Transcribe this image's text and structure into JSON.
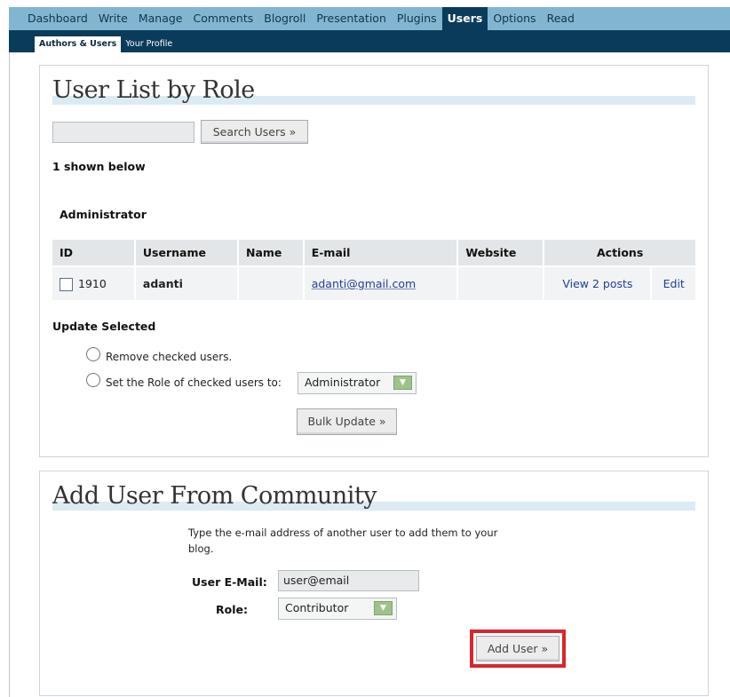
{
  "top_nav": {
    "items": [
      {
        "label": "Dashboard"
      },
      {
        "label": "Write"
      },
      {
        "label": "Manage"
      },
      {
        "label": "Comments"
      },
      {
        "label": "Blogroll"
      },
      {
        "label": "Presentation"
      },
      {
        "label": "Plugins"
      },
      {
        "label": "Users",
        "active": true
      },
      {
        "label": "Options"
      },
      {
        "label": "Read"
      }
    ]
  },
  "sub_nav": {
    "items": [
      {
        "label": "Authors & Users",
        "active": true
      },
      {
        "label": "Your Profile"
      }
    ]
  },
  "user_list": {
    "title": "User List by Role",
    "search_value": "",
    "search_button": "Search Users »",
    "shown_count": "1 shown below",
    "role_heading": "Administrator",
    "columns": [
      "ID",
      "Username",
      "Name",
      "E-mail",
      "Website",
      "Actions"
    ],
    "rows": [
      {
        "checked": false,
        "id": "1910",
        "username": "adanti",
        "name": "",
        "email": "adanti@gmail.com",
        "website": "",
        "view_posts": "View 2 posts",
        "edit": "Edit"
      }
    ],
    "update_selected": "Update Selected",
    "option_remove": "Remove checked users.",
    "option_set_role": "Set the Role of checked users to:",
    "role_select_value": "Administrator",
    "bulk_update_button": "Bulk Update »"
  },
  "add_user": {
    "title": "Add User From Community",
    "instructions": "Type the e-mail address of another user to add them to your",
    "instructions_2": "blog.",
    "email_label": "User E-Mail:",
    "email_value": "user@email",
    "role_label": "Role:",
    "role_value": "Contributor",
    "add_button": "Add User »"
  },
  "colors": {
    "top_nav_bg": "#82b6d0",
    "nav_active_bg": "#0b3b5a",
    "highlight": "#d9262c",
    "select_arrow": "#9ec38a"
  }
}
